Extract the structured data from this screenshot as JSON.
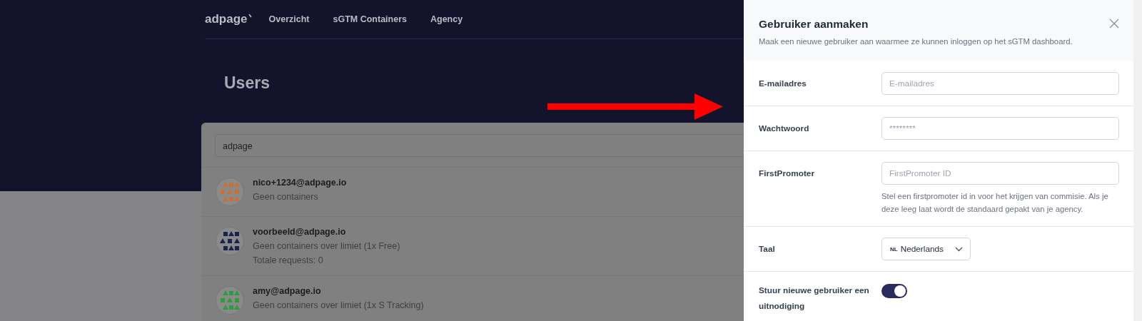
{
  "nav": {
    "logo": "adpage",
    "items": [
      "Overzicht",
      "sGTM Containers",
      "Agency"
    ]
  },
  "page_title": "Users",
  "search": {
    "value": "adpage"
  },
  "users": [
    {
      "email": "nico+1234@adpage.io",
      "lines": [
        "Geen containers"
      ],
      "color": "#c8703a"
    },
    {
      "email": "voorbeeld@adpage.io",
      "lines": [
        "Geen containers over limiet (1x Free)",
        "Totale requests: 0"
      ],
      "color": "#1b2150"
    },
    {
      "email": "amy@adpage.io",
      "lines": [
        "Geen containers over limiet (1x S Tracking)"
      ],
      "color": "#2e9a3e"
    }
  ],
  "panel": {
    "title": "Gebruiker aanmaken",
    "description": "Maak een nieuwe gebruiker aan waarmee ze kunnen inloggen op het sGTM dashboard.",
    "fields": [
      {
        "kind": "text",
        "label": "E-mailadres",
        "placeholder": "E-mailadres"
      },
      {
        "kind": "password",
        "label": "Wachtwoord",
        "placeholder": "********"
      },
      {
        "kind": "text",
        "label": "FirstPromoter",
        "placeholder": "FirstPromoter ID",
        "help": "Stel een firstpromoter id in voor het krijgen van commisie. Als je deze leeg laat wordt de standaard gepakt van je agency."
      },
      {
        "kind": "select",
        "label": "Taal",
        "flag": "NL",
        "value": "Nederlands"
      },
      {
        "kind": "toggle",
        "label": "Stuur nieuwe gebruiker een uitnodiging",
        "on": true
      }
    ]
  }
}
